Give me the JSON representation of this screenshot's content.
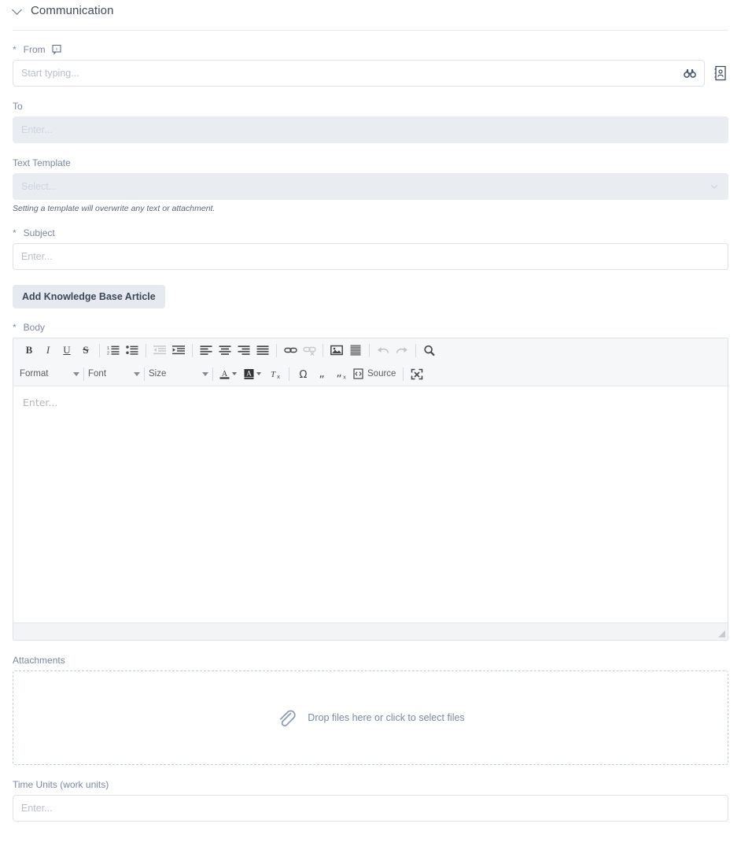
{
  "section": {
    "title": "Communication",
    "collapse_icon": "chevron-down-icon"
  },
  "fields": {
    "from": {
      "required_mark": "*",
      "label": "From",
      "info_icon": "info-tooltip-icon",
      "placeholder": "Start typing...",
      "value": "",
      "search_icon": "binoculars-icon",
      "contact_icon": "address-book-icon"
    },
    "to": {
      "label": "To",
      "placeholder": "Enter...",
      "value": "",
      "disabled": true
    },
    "text_template": {
      "label": "Text Template",
      "placeholder": "Select...",
      "value": "",
      "disabled": true,
      "dropdown_icon": "chevron-down-icon",
      "hint": "Setting a template will overwrite any text or attachment."
    },
    "subject": {
      "required_mark": "*",
      "label": "Subject",
      "placeholder": "Enter...",
      "value": ""
    },
    "body": {
      "required_mark": "*",
      "label": "Body",
      "placeholder": "Enter...",
      "value": ""
    },
    "attachments": {
      "label": "Attachments",
      "dropzone_text": "Drop files here or click to select files",
      "icon": "paperclip-icon"
    },
    "time_units": {
      "label": "Time Units (work units)",
      "placeholder": "Enter...",
      "value": ""
    }
  },
  "buttons": {
    "add_kb_article": "Add Knowledge Base Article"
  },
  "editor_toolbar": {
    "row1": [
      {
        "name": "bold-icon",
        "label": "B",
        "type": "icon",
        "disabled": false
      },
      {
        "name": "italic-icon",
        "label": "I",
        "type": "icon",
        "disabled": false
      },
      {
        "name": "underline-icon",
        "label": "U",
        "type": "icon",
        "disabled": false
      },
      {
        "name": "strikethrough-icon",
        "label": "S",
        "type": "icon",
        "disabled": false
      },
      {
        "name": "separator",
        "label": "",
        "type": "sep",
        "disabled": false
      },
      {
        "name": "numbered-list-icon",
        "label": "",
        "type": "icon",
        "disabled": false
      },
      {
        "name": "bulleted-list-icon",
        "label": "",
        "type": "icon",
        "disabled": false
      },
      {
        "name": "separator",
        "label": "",
        "type": "sep",
        "disabled": false
      },
      {
        "name": "decrease-indent-icon",
        "label": "",
        "type": "icon",
        "disabled": true
      },
      {
        "name": "increase-indent-icon",
        "label": "",
        "type": "icon",
        "disabled": false
      },
      {
        "name": "separator",
        "label": "",
        "type": "sep",
        "disabled": false
      },
      {
        "name": "align-left-icon",
        "label": "",
        "type": "icon",
        "disabled": false
      },
      {
        "name": "align-center-icon",
        "label": "",
        "type": "icon",
        "disabled": false
      },
      {
        "name": "align-right-icon",
        "label": "",
        "type": "icon",
        "disabled": false
      },
      {
        "name": "justify-icon",
        "label": "",
        "type": "icon",
        "disabled": false
      },
      {
        "name": "separator",
        "label": "",
        "type": "sep",
        "disabled": false
      },
      {
        "name": "link-icon",
        "label": "",
        "type": "icon",
        "disabled": false
      },
      {
        "name": "unlink-icon",
        "label": "",
        "type": "icon",
        "disabled": true
      },
      {
        "name": "separator",
        "label": "",
        "type": "sep",
        "disabled": false
      },
      {
        "name": "image-icon",
        "label": "",
        "type": "icon",
        "disabled": false
      },
      {
        "name": "horizontal-rule-icon",
        "label": "",
        "type": "icon",
        "disabled": false
      },
      {
        "name": "separator",
        "label": "",
        "type": "sep",
        "disabled": false
      },
      {
        "name": "undo-icon",
        "label": "",
        "type": "icon",
        "disabled": true
      },
      {
        "name": "redo-icon",
        "label": "",
        "type": "icon",
        "disabled": true
      },
      {
        "name": "separator",
        "label": "",
        "type": "sep",
        "disabled": false
      },
      {
        "name": "find-icon",
        "label": "",
        "type": "icon",
        "disabled": false
      }
    ],
    "row2": {
      "format_label": "Format",
      "font_label": "Font",
      "size_label": "Size",
      "source_label": "Source",
      "text_color_icon": "text-color-icon",
      "background_color_icon": "background-color-icon",
      "remove_format_icon": "remove-format-icon",
      "special_char_icon": "special-character-icon",
      "blockquote_icon": "add-quote-icon",
      "remove_quote_icon": "remove-quote-icon",
      "source_icon": "source-code-icon",
      "maximize_icon": "maximize-icon"
    }
  },
  "colors": {
    "label": "#7c89a0",
    "title": "#3f4c5e",
    "field_border": "#dfe3e8",
    "disabled_bg": "#e9ecf1",
    "toolbar_bg": "#f6f7f9",
    "accent_text": "#7b8aa3"
  }
}
